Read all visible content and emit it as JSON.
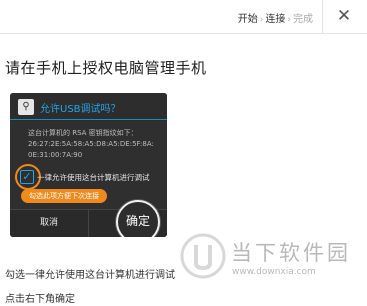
{
  "header": {
    "steps": [
      "开始",
      "连接",
      "完成"
    ],
    "close_glyph": "✕"
  },
  "title": "请在手机上授权电脑管理手机",
  "dialog": {
    "title": "允许USB调试吗？",
    "text_lines": [
      "这台计算机的 RSA 密钥指纹如下：",
      "26:27:2E:5A:58:A5:D8:A5:DE:5F:8A:",
      "0E:31:00:7A:90"
    ],
    "checkbox_label": "一律允许使用这台计算机进行调试",
    "checkbox_checked": true,
    "hint": "勾选此项方便下次连接",
    "cancel": "取消",
    "ok": "确定"
  },
  "watermark": {
    "name": "当下软件园",
    "url": "www.downxia.com"
  },
  "instructions": [
    "勾选一律允许使用这台计算机进行调试",
    "点击右下角确定"
  ]
}
